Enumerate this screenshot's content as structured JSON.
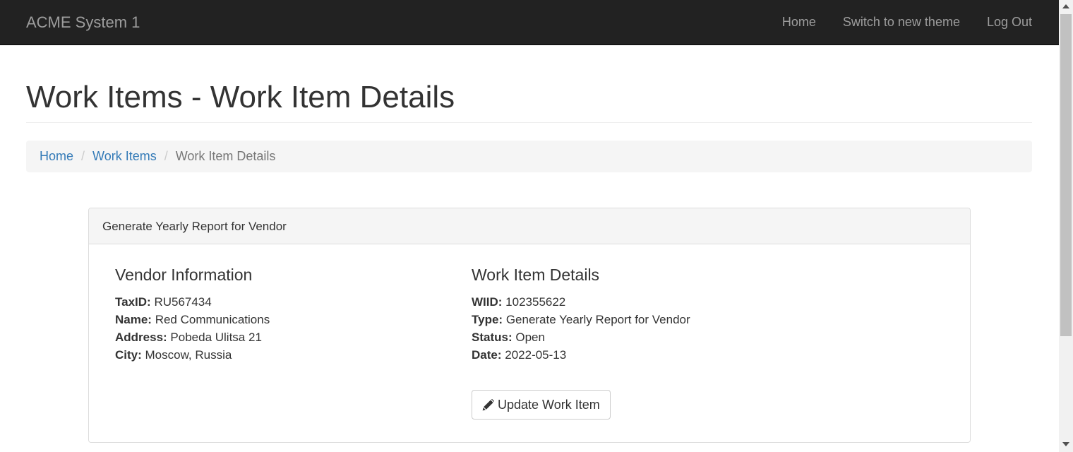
{
  "navbar": {
    "brand": "ACME System 1",
    "links": [
      "Home",
      "Switch to new theme",
      "Log Out"
    ],
    "background": "#222222",
    "text_color": "#9d9d9d"
  },
  "page": {
    "title": "Work Items - Work Item Details"
  },
  "breadcrumb": {
    "items": [
      "Home",
      "Work Items"
    ],
    "active": "Work Item Details",
    "separator": "/"
  },
  "panel": {
    "heading": "Generate Yearly Report for Vendor",
    "vendor": {
      "title": "Vendor Information",
      "fields": [
        {
          "label": "TaxID:",
          "value": "RU567434"
        },
        {
          "label": "Name:",
          "value": "Red Communications"
        },
        {
          "label": "Address:",
          "value": "Pobeda Ulitsa 21"
        },
        {
          "label": "City:",
          "value": "Moscow, Russia"
        }
      ]
    },
    "work_item": {
      "title": "Work Item Details",
      "fields": [
        {
          "label": "WIID:",
          "value": "102355622"
        },
        {
          "label": "Type:",
          "value": "Generate Yearly Report for Vendor"
        },
        {
          "label": "Status:",
          "value": "Open"
        },
        {
          "label": "Date:",
          "value": "2022-05-13"
        }
      ]
    },
    "update_button": {
      "icon": "pencil-icon",
      "label": "Update Work Item"
    }
  },
  "colors": {
    "link": "#337ab7",
    "breadcrumb_bg": "#f5f5f5"
  }
}
